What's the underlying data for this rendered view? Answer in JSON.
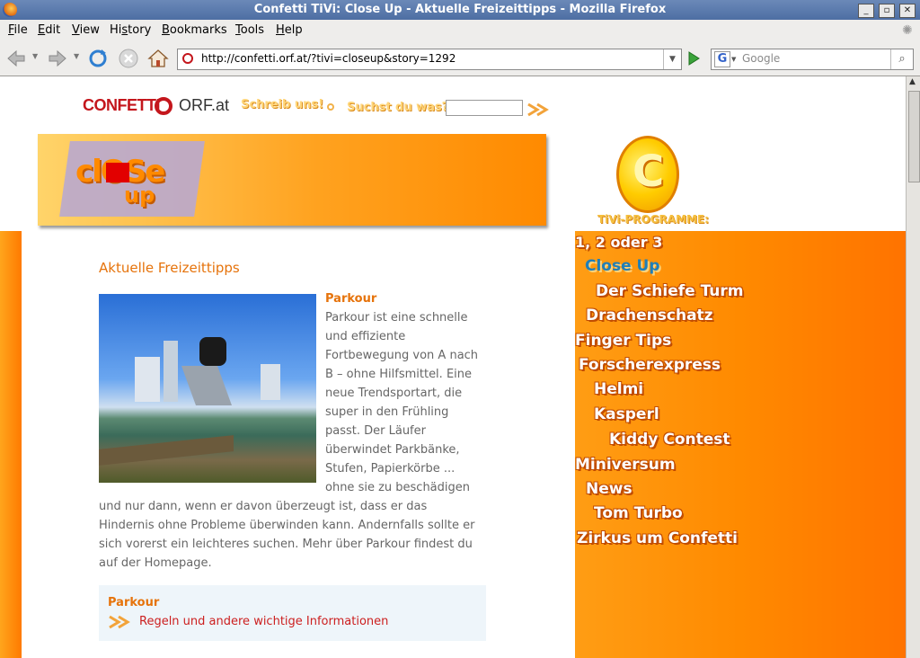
{
  "window": {
    "title": "Confetti TiVi: Close Up - Aktuelle Freizeittipps - Mozilla Firefox"
  },
  "menu": [
    {
      "label": "File",
      "u": "F"
    },
    {
      "label": "Edit",
      "u": "E"
    },
    {
      "label": "View",
      "u": "V"
    },
    {
      "label": "History",
      "u": "s"
    },
    {
      "label": "Bookmarks",
      "u": "B"
    },
    {
      "label": "Tools",
      "u": "T"
    },
    {
      "label": "Help",
      "u": "H"
    }
  ],
  "nav": {
    "url": "http://confetti.orf.at/?tivi=closeup&story=1292",
    "search_placeholder": "Google"
  },
  "header": {
    "logo_confetti": "CONFETTI",
    "logo_orf": "ORF.at",
    "schreib": "Schreib uns!",
    "suchst": "Suchst du was?",
    "banner_close": "clOSe",
    "banner_up": "up"
  },
  "sidebar": {
    "tivi_label": "TiVi-PROGRAMME:",
    "items": [
      "1, 2 oder 3",
      "Close Up",
      "Der Schiefe Turm",
      "Drachenschatz",
      "Finger Tips",
      "Forscherexpress",
      "Helmi",
      "Kasperl",
      "Kiddy Contest",
      "Miniversum",
      "News",
      "Tom Turbo",
      "Zirkus um Confetti"
    ]
  },
  "article": {
    "heading": "Aktuelle Freizeittipps",
    "subheading": "Parkour",
    "body": "Parkour ist eine schnelle und effiziente Fortbewegung von A nach B – ohne Hilfsmittel. Eine neue Trendsportart, die super in den Frühling passt. Der Läufer überwindet Parkbänke, Stufen, Papierkörbe ... ohne sie zu beschädigen und nur dann, wenn er davon überzeugt ist, dass er das Hindernis ohne Probleme überwinden kann. Andernfalls sollte er sich vorerst ein leichteres suchen. Mehr über Parkour findest du auf der Homepage.",
    "wrap_lines": [
      "Parkour ist eine schnelle",
      "und effiziente",
      "Fortbewegung von A nach",
      "B – ohne Hilfsmittel. Eine",
      "neue Trendsportart, die",
      "super in den Frühling",
      "passt. Der Läufer",
      "überwindet Parkbänke,",
      "Stufen, Papierkörbe ...",
      "ohne sie zu beschädigen"
    ],
    "full_lines": [
      "und nur dann, wenn er davon überzeugt ist, dass er das",
      "Hindernis ohne Probleme überwinden kann. Andernfalls sollte er",
      "sich vorerst ein leichteres suchen. Mehr über Parkour findest du",
      "auf der Homepage."
    ],
    "box_title": "Parkour",
    "box_link": "Regeln und andere wichtige Informationen"
  },
  "colors": {
    "accent": "#ff8a00",
    "link": "#cc1f1f",
    "box_bg": "#eef5fa"
  }
}
